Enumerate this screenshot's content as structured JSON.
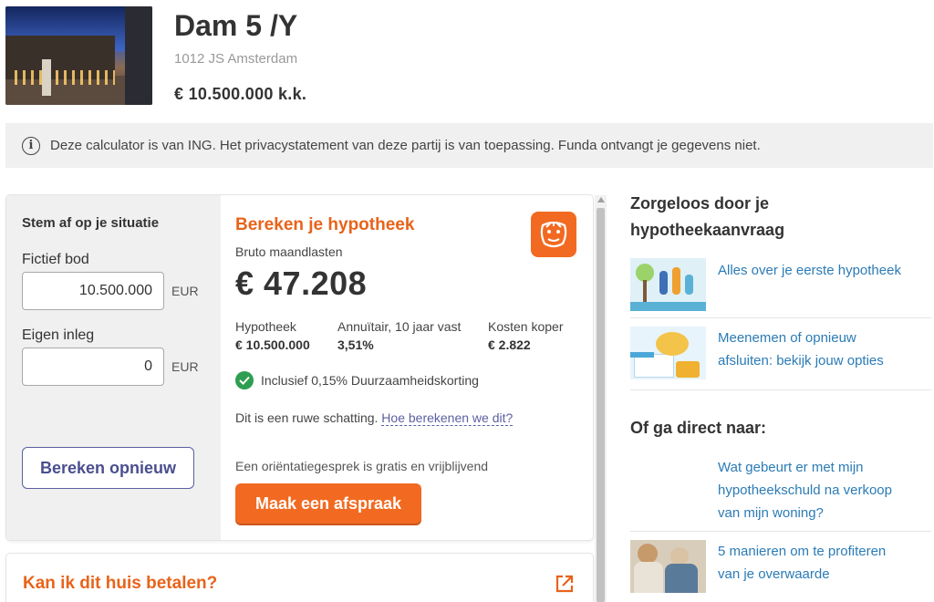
{
  "listing": {
    "title": "Dam 5 /Y",
    "address": "1012 JS Amsterdam",
    "price": "€ 10.500.000 k.k."
  },
  "notice": {
    "text": "Deze calculator is van ING. Het privacystatement van deze partij is van toepassing. Funda ontvangt je gegevens niet."
  },
  "calculator": {
    "situation_header": "Stem af op je situatie",
    "bid_label": "Fictief bod",
    "bid_value": "10.500.000",
    "currency": "EUR",
    "own_label": "Eigen inleg",
    "own_value": "0",
    "recalc_button": "Bereken opnieuw",
    "title": "Bereken je hypotheek",
    "subtitle": "Bruto maandlasten",
    "amount": "€ 47.208",
    "columns": [
      {
        "label": "Hypotheek",
        "value": "€ 10.500.000"
      },
      {
        "label": "Annuïtair, 10 jaar vast",
        "value": "3,51%"
      },
      {
        "label": "Kosten koper",
        "value": "€ 2.822"
      }
    ],
    "badge": "Inclusief 0,15% Duurzaamheidskorting",
    "estimate_text": "Dit is een ruwe schatting.",
    "estimate_link": "Hoe berekenen we dit?",
    "orient_text": "Een oriëntatiegesprek is gratis en vrijblijvend",
    "appointment_button": "Maak een afspraak"
  },
  "afford": {
    "title": "Kan ik dit huis betalen?"
  },
  "sidebar": {
    "heading1_line1": "Zorgeloos door je",
    "heading1_line2": "hypotheekaanvraag",
    "items1": [
      {
        "label": "Alles over je eerste hypotheek"
      },
      {
        "label_line1": "Meenemen of opnieuw",
        "label_line2": "afsluiten: bekijk jouw opties"
      }
    ],
    "heading2": "Of ga direct naar:",
    "items2": [
      {
        "label_line1": "Wat gebeurt er met mijn",
        "label_line2": "hypotheekschuld na verkoop",
        "label_line3": "van mijn woning?"
      },
      {
        "label_line1": "5 manieren om te profiteren",
        "label_line2": "van je overwaarde"
      }
    ]
  },
  "colors": {
    "accent_orange": "#f26a21",
    "link_blue": "#2b7bb6",
    "button_purple": "#4a4f8f",
    "check_green": "#2e9e50"
  },
  "icons": [
    "info-icon",
    "ing-lion-logo",
    "check-circle-icon",
    "external-link-icon"
  ]
}
